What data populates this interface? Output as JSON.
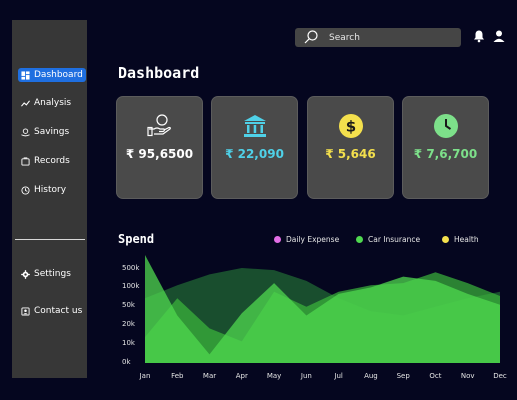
{
  "nav": {
    "dashboard": "Dashboard",
    "analysis": "Analysis",
    "savings": "Savings",
    "records": "Records",
    "history": "History",
    "settings": "Settings",
    "contact": "Contact us"
  },
  "search": {
    "placeholder": "Search"
  },
  "page_title": "Dashboard",
  "cards": [
    {
      "icon": "hand-coin-icon",
      "amount": "₹ 95,6500",
      "color": "#ffffff"
    },
    {
      "icon": "bank-icon",
      "amount": "₹ 22,090",
      "color": "#4fd1e8"
    },
    {
      "icon": "dollar-coin-icon",
      "amount": "₹ 5,646",
      "color": "#f4e04d"
    },
    {
      "icon": "clock-icon",
      "amount": "₹ 7,6,700",
      "color": "#7de08a"
    }
  ],
  "spend": {
    "title": "Spend",
    "legend": [
      {
        "label": "Daily Expense",
        "color": "#e36ee6"
      },
      {
        "label": "Car Insurance",
        "color": "#4fd84f"
      },
      {
        "label": "Health",
        "color": "#f4e04d"
      }
    ]
  },
  "chart_data": {
    "type": "area",
    "categories": [
      "Jan",
      "Feb",
      "Mar",
      "Apr",
      "May",
      "Jun",
      "Jul",
      "Aug",
      "Sep",
      "Oct",
      "Nov",
      "Dec"
    ],
    "y_ticks": [
      "500k",
      "100k",
      "50k",
      "20k",
      "10k",
      "0k"
    ],
    "series": [
      {
        "color": "#4fd84f",
        "values": [
          5,
          2.2,
          0.4,
          2.3,
          3.7,
          2.2,
          3.2,
          3.5,
          4.0,
          3.8,
          3.2,
          2.7
        ]
      },
      {
        "color": "#3cb83c",
        "values": [
          1.2,
          3.0,
          1.6,
          1.0,
          3.3,
          2.6,
          3.3,
          3.6,
          3.7,
          4.2,
          3.7,
          3.1
        ]
      },
      {
        "color": "#2a8a3a",
        "values": [
          3.0,
          3.6,
          4.1,
          4.4,
          4.3,
          3.8,
          3.0,
          2.4,
          2.2,
          2.6,
          3.0,
          3.3
        ]
      }
    ],
    "ylim": [
      0,
      5
    ]
  }
}
